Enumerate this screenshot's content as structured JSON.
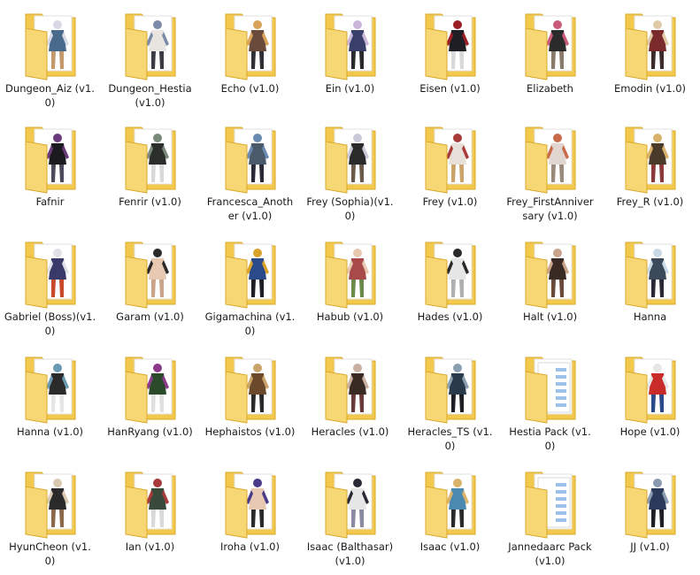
{
  "folders": [
    {
      "label": "Dungeon_Aiz (v1.0)",
      "icon": "character-thumbnail-icon",
      "colors": [
        "#4a6a8c",
        "#d9d9e6",
        "#c49a6c"
      ]
    },
    {
      "label": "Dungeon_Hestia (v1.0)",
      "icon": "character-thumbnail-icon",
      "colors": [
        "#e8e4e0",
        "#7b8aa6",
        "#3b3b46"
      ]
    },
    {
      "label": "Echo (v1.0)",
      "icon": "character-thumbnail-icon",
      "colors": [
        "#6a4a3a",
        "#d9a35a",
        "#2f2f36"
      ]
    },
    {
      "label": "Ein (v1.0)",
      "icon": "character-thumbnail-icon",
      "colors": [
        "#3a3f6a",
        "#c9b6d9",
        "#2a2a2a"
      ]
    },
    {
      "label": "Eisen (v1.0)",
      "icon": "character-thumbnail-icon",
      "colors": [
        "#1e1e24",
        "#9a1e24",
        "#d9d9d9"
      ]
    },
    {
      "label": "Elizabeth",
      "icon": "character-thumbnail-icon",
      "colors": [
        "#2b2b2b",
        "#c95a7a",
        "#8a7a6a"
      ]
    },
    {
      "label": "Emodin (v1.0)",
      "icon": "character-thumbnail-icon",
      "colors": [
        "#7a2a2a",
        "#e0c9a6",
        "#3b2b2b"
      ]
    },
    {
      "label": "Fafnir",
      "icon": "character-thumbnail-icon",
      "colors": [
        "#1a1a1f",
        "#6a3a7a",
        "#4a4a5a"
      ]
    },
    {
      "label": "Fenrir (v1.0)",
      "icon": "character-thumbnail-icon",
      "colors": [
        "#2a2f2a",
        "#7a8a7a",
        "#d9d9d9"
      ]
    },
    {
      "label": "Francesca_Another (v1.0)",
      "icon": "character-thumbnail-icon",
      "colors": [
        "#4a5a6a",
        "#6a8ab0",
        "#2a2a36"
      ]
    },
    {
      "label": "Frey (Sophia)(v1.0)",
      "icon": "character-thumbnail-icon",
      "colors": [
        "#2a2a2a",
        "#c9c9d9",
        "#6a5a4a"
      ]
    },
    {
      "label": "Frey (v1.0)",
      "icon": "character-thumbnail-icon",
      "colors": [
        "#e6e0d9",
        "#a83a3a",
        "#c9a36a"
      ]
    },
    {
      "label": "Frey_FirstAnniversary (v1.0)",
      "icon": "character-thumbnail-icon",
      "colors": [
        "#e0d6cf",
        "#c96a4a",
        "#9a8a7a"
      ]
    },
    {
      "label": "Frey_R (v1.0)",
      "icon": "character-thumbnail-icon",
      "colors": [
        "#4a3a2a",
        "#d9b36a",
        "#8a3a3a"
      ]
    },
    {
      "label": "Gabriel (Boss)(v1.0)",
      "icon": "character-thumbnail-icon",
      "colors": [
        "#3a3a6a",
        "#e0e0e6",
        "#c94a2a"
      ]
    },
    {
      "label": "Garam (v1.0)",
      "icon": "character-thumbnail-icon",
      "colors": [
        "#e6c9b0",
        "#2a2a2a",
        "#c9a38a"
      ]
    },
    {
      "label": "Gigamachina (v1.0)",
      "icon": "character-thumbnail-icon",
      "colors": [
        "#2a4a8a",
        "#d9a32a",
        "#1e1e24"
      ]
    },
    {
      "label": "Habub (v1.0)",
      "icon": "character-thumbnail-icon",
      "colors": [
        "#a84a4a",
        "#e6c9b0",
        "#6a8a4a"
      ]
    },
    {
      "label": "Hades (v1.0)",
      "icon": "character-thumbnail-icon",
      "colors": [
        "#e6e6e6",
        "#2a2a2a",
        "#b0b0b0"
      ]
    },
    {
      "label": "Halt (v1.0)",
      "icon": "character-thumbnail-icon",
      "colors": [
        "#3a2a24",
        "#c9a38a",
        "#6a4a3a"
      ]
    },
    {
      "label": "Hanna",
      "icon": "character-thumbnail-icon",
      "colors": [
        "#3a4a5a",
        "#c9d9e6",
        "#2a2a36"
      ]
    },
    {
      "label": "Hanna (v1.0)",
      "icon": "character-thumbnail-icon",
      "colors": [
        "#2a2a2a",
        "#6a9ab0",
        "#e6e6e6"
      ]
    },
    {
      "label": "HanRyang (v1.0)",
      "icon": "character-thumbnail-icon",
      "colors": [
        "#2a4a2a",
        "#8a3a8a",
        "#e0e0e0"
      ]
    },
    {
      "label": "Hephaistos (v1.0)",
      "icon": "character-thumbnail-icon",
      "colors": [
        "#6a4a2a",
        "#c9a36a",
        "#2a2a2a"
      ]
    },
    {
      "label": "Heracles (v1.0)",
      "icon": "character-thumbnail-icon",
      "colors": [
        "#3a2a24",
        "#c9b0a0",
        "#6a3a3a"
      ]
    },
    {
      "label": "Heracles_TS (v1.0)",
      "icon": "character-thumbnail-icon",
      "colors": [
        "#2a3a4a",
        "#8aa0b0",
        "#1e1e24"
      ]
    },
    {
      "label": "Hestia Pack (v1.0)",
      "icon": "folder-pages-icon",
      "colors": [
        "#ffffff",
        "#4a90d9",
        "#d9d9d9"
      ]
    },
    {
      "label": "Hope (v1.0)",
      "icon": "character-thumbnail-icon",
      "colors": [
        "#c92a2a",
        "#e6e6e6",
        "#2a4a8a"
      ]
    },
    {
      "label": "HyunCheon (v1.0)",
      "icon": "character-thumbnail-icon",
      "colors": [
        "#2a2a2a",
        "#d9c9b0",
        "#8a6a4a"
      ]
    },
    {
      "label": "Ian (v1.0)",
      "icon": "character-thumbnail-icon",
      "colors": [
        "#3a4a3a",
        "#a83a3a",
        "#d9d9d9"
      ]
    },
    {
      "label": "Iroha (v1.0)",
      "icon": "character-thumbnail-icon",
      "colors": [
        "#e6c9b0",
        "#4a3a8a",
        "#2a2a2a"
      ]
    },
    {
      "label": "Isaac (Balthasar)(v1.0)",
      "icon": "character-thumbnail-icon",
      "colors": [
        "#e6e6e6",
        "#2a2a36",
        "#8a8aa0"
      ]
    },
    {
      "label": "Isaac (v1.0)",
      "icon": "character-thumbnail-icon",
      "colors": [
        "#4a8ab0",
        "#d9b36a",
        "#2a2a2a"
      ]
    },
    {
      "label": "Jannedaarc Pack (v1.0)",
      "icon": "folder-pages-icon",
      "colors": [
        "#ffffff",
        "#4a90d9",
        "#d9d9d9"
      ]
    },
    {
      "label": "JJ (v1.0)",
      "icon": "character-thumbnail-icon",
      "colors": [
        "#2a3a5a",
        "#8a9ab0",
        "#1e1e24"
      ]
    }
  ]
}
